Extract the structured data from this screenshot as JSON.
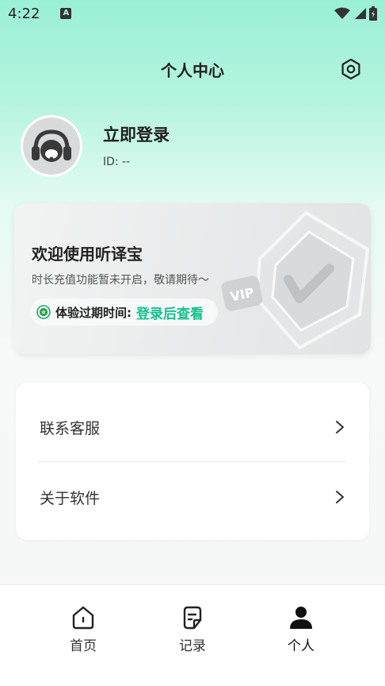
{
  "status_bar": {
    "time": "4:22",
    "notification_icon": "A"
  },
  "header": {
    "title": "个人中心"
  },
  "profile": {
    "login_label": "立即登录",
    "id_text": "ID: --"
  },
  "vip_card": {
    "welcome": "欢迎使用听译宝",
    "subtitle": "时长充值功能暂未开启，敬请期待～",
    "expiry_label": "体验过期时间:",
    "expiry_value": "登录后查看",
    "badge_text": "VIP"
  },
  "menu": {
    "items": [
      {
        "label": "联系客服"
      },
      {
        "label": "关于软件"
      }
    ]
  },
  "tabbar": {
    "items": [
      {
        "label": "首页",
        "icon": "home-icon"
      },
      {
        "label": "记录",
        "icon": "document-icon"
      },
      {
        "label": "个人",
        "icon": "person-icon",
        "active": true
      }
    ]
  },
  "colors": {
    "accent_green": "#13c28e",
    "header_gradient_top": "#9af0d6"
  }
}
